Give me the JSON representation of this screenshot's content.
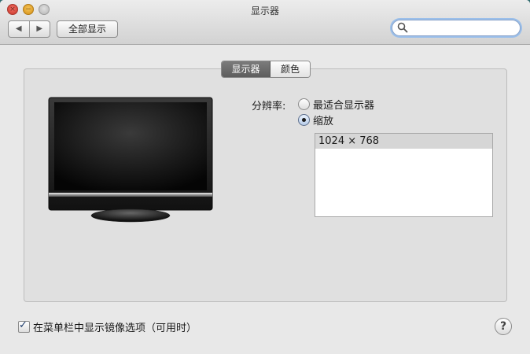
{
  "window": {
    "title": "显示器",
    "traffic": {
      "close": "×",
      "minimize": "−",
      "zoom": "+"
    }
  },
  "toolbar": {
    "back_glyph": "◀",
    "forward_glyph": "▶",
    "show_all_label": "全部显示",
    "search_placeholder": ""
  },
  "tabs": [
    {
      "label": "显示器",
      "active": true
    },
    {
      "label": "颜色",
      "active": false
    }
  ],
  "resolution": {
    "label": "分辨率:",
    "options": [
      {
        "label": "最适合显示器",
        "selected": false
      },
      {
        "label": "缩放",
        "selected": true
      }
    ],
    "list": [
      "1024 × 768"
    ]
  },
  "footer": {
    "mirror_checkbox_label": "在菜单栏中显示镜像选项（可用时）",
    "mirror_checked": true,
    "help_label": "?"
  },
  "colors": {
    "accent": "#5b8ed6",
    "panel": "#e0e0e0",
    "selected_row": "#d6d6d6"
  },
  "icons": [
    "search-icon",
    "monitor-icon",
    "help-icon"
  ]
}
